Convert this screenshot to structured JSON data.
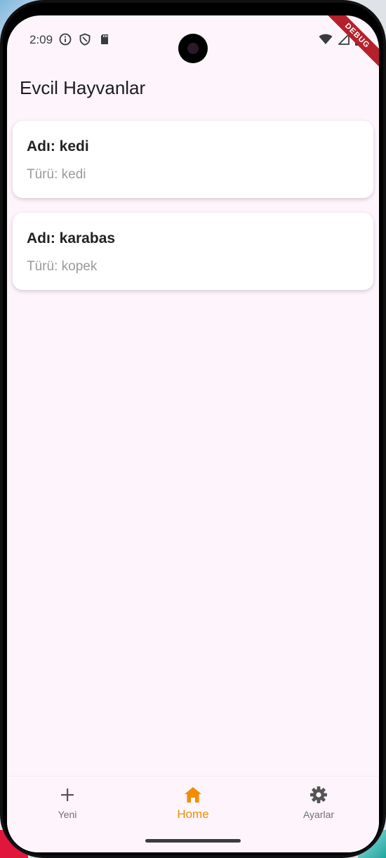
{
  "status_bar": {
    "time": "2:09",
    "debug_banner": "DEBUG"
  },
  "app_bar": {
    "title": "Evcil Hayvanlar"
  },
  "pets": [
    {
      "name": "Adı: kedi",
      "type": "Türü: kedi"
    },
    {
      "name": "Adı: karabas",
      "type": "Türü: kopek"
    }
  ],
  "bottom_nav": {
    "items": [
      {
        "label": "Yeni",
        "icon": "plus-icon"
      },
      {
        "label": "Home",
        "icon": "home-icon",
        "active": true
      },
      {
        "label": "Ayarlar",
        "icon": "gear-icon"
      }
    ]
  },
  "colors": {
    "background": "#fdf5fb",
    "accent": "#f28c00",
    "card": "#ffffff",
    "debug": "#b5202b"
  }
}
